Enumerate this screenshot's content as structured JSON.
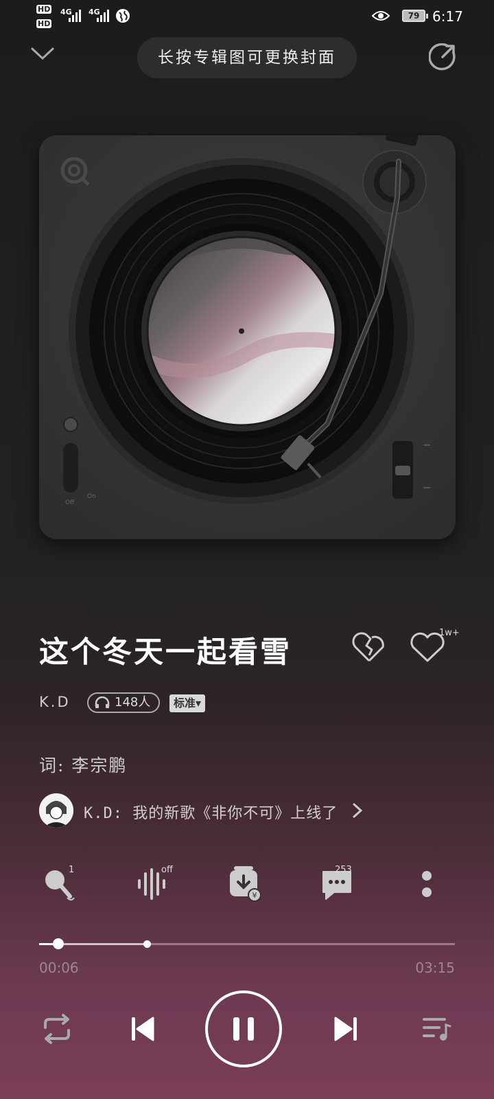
{
  "status_bar": {
    "hd1": "HD",
    "hd2": "HD",
    "sig1": "4G",
    "sig2": "4G",
    "battery": "79",
    "time": "6:17"
  },
  "header": {
    "hint": "长按专辑图可更换封面"
  },
  "turntable": {
    "switch_off_label": "Off",
    "switch_on_label": "On"
  },
  "song": {
    "title": "这个冬天一起看雪",
    "artist": "K.D",
    "listeners": "148人",
    "quality": "标准▾",
    "like_count": "1w+",
    "lyricist": "词: 李宗鹏",
    "news": "K.D: 我的新歌《非你不可》上线了"
  },
  "actions": {
    "sing_badge": "1",
    "effect_badge": "off",
    "comment_count": "253"
  },
  "player": {
    "current_time": "00:06",
    "total_time": "03:15",
    "progress": 0.046,
    "buffered": 0.26
  },
  "colors": {
    "accent": "#ffffff",
    "bg_bottom": "#7a3d58"
  }
}
